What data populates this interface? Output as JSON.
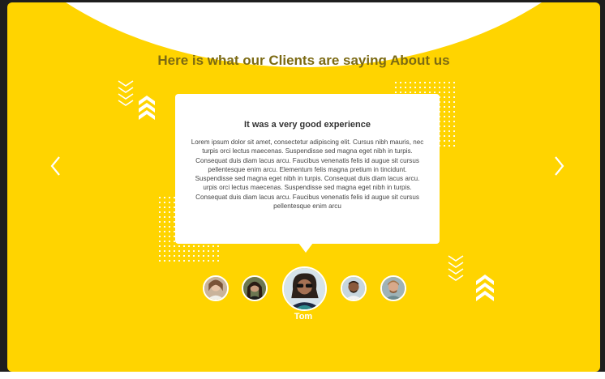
{
  "section": {
    "heading": "Here is what our Clients are saying About us"
  },
  "testimonial": {
    "title": "It was a very good experience",
    "body": "Lorem ipsum dolor sit amet, consectetur adipiscing elit. Cursus nibh mauris, nec turpis orci lectus maecenas. Suspendisse sed magna eget nibh in turpis. Consequat duis diam lacus arcu. Faucibus venenatis felis id augue sit cursus pellentesque enim arcu. Elementum felis magna pretium in tincidunt. Suspendisse sed magna eget nibh in turpis. Consequat duis diam lacus arcu. urpis orci lectus maecenas. Suspendisse sed magna eget nibh in turpis. Consequat duis diam lacus arcu. Faucibus venenatis felis id augue sit cursus pellentesque enim arcu"
  },
  "carousel": {
    "prev_icon": "chevron-left-icon",
    "next_icon": "chevron-right-icon",
    "active_client_name": "Tom"
  },
  "colors": {
    "background": "#ffd400",
    "heading_text": "#7c6a13",
    "card": "#ffffff",
    "accent_white": "#ffffff"
  }
}
